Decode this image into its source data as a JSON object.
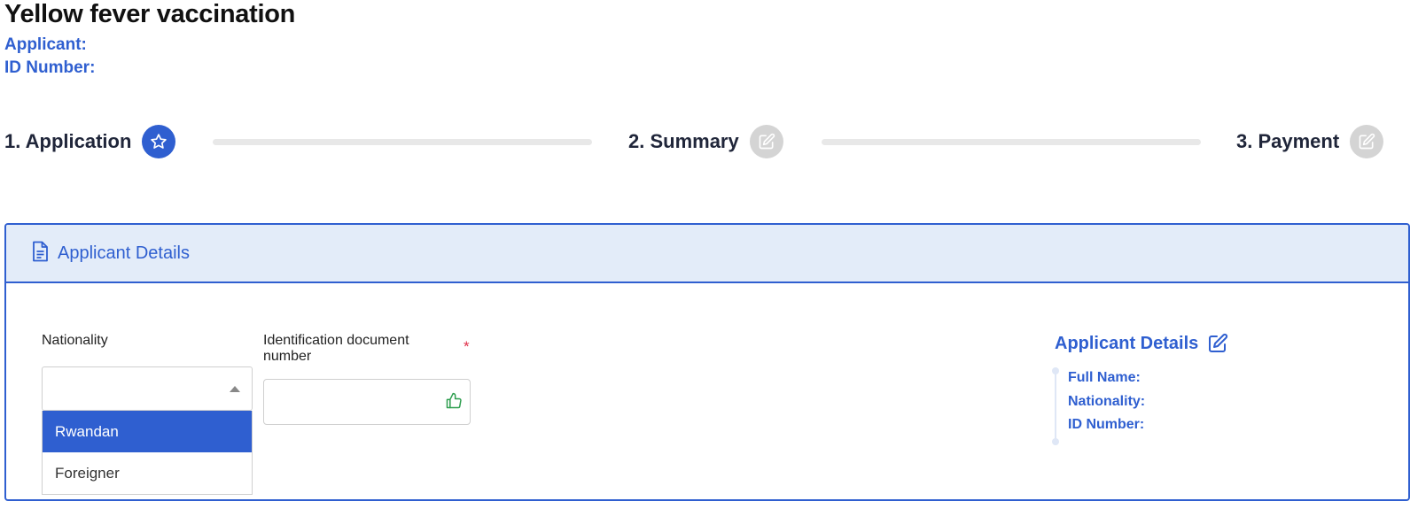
{
  "page": {
    "title": "Yellow fever vaccination",
    "applicant_label": "Applicant:",
    "id_number_label": "ID Number:"
  },
  "stepper": {
    "steps": [
      {
        "label": "1. Application",
        "state": "active",
        "icon": "star-icon"
      },
      {
        "label": "2. Summary",
        "state": "inactive",
        "icon": "edit-icon"
      },
      {
        "label": "3. Payment",
        "state": "inactive",
        "icon": "edit-icon"
      }
    ]
  },
  "card": {
    "header_title": "Applicant Details",
    "header_icon": "document-icon",
    "nationality": {
      "label": "Nationality",
      "value": "",
      "options": [
        "Rwandan",
        "Foreigner"
      ],
      "highlighted": "Rwandan"
    },
    "id_document": {
      "label": "Identification document number",
      "required_mark": "*",
      "value": ""
    },
    "summary": {
      "title": "Applicant Details",
      "items": [
        "Full Name:",
        "Nationality:",
        "ID Number:"
      ]
    }
  },
  "colors": {
    "accent": "#2f5fd0",
    "header_bg": "#e3ecf9",
    "inactive_step": "#d4d4d4",
    "required": "#e0304a",
    "valid_icon": "#2e9e4f"
  }
}
